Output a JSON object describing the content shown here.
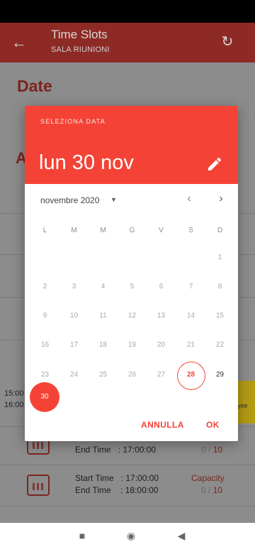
{
  "app_bar": {
    "title": "Time Slots",
    "subtitle": "SALA RIUNIONI",
    "back_icon": "arrow-left-icon",
    "refresh_icon": "refresh-icon"
  },
  "background": {
    "date_heading": "Date",
    "second_heading_partial": "A",
    "side_times": [
      "15:00",
      "16:00"
    ],
    "slots": [
      {
        "end_label": "End Time",
        "end_value": ": 17:00:00",
        "capacity_used": "0",
        "capacity_total": "10"
      },
      {
        "start_label": "Start Time",
        "start_value": ": 17:00:00",
        "end_label": "End Time",
        "end_value": ": 18:00:00",
        "capacity_label": "Capacity",
        "capacity_used": "0",
        "capacity_total": "10"
      }
    ],
    "yellow_chip": "yee"
  },
  "dialog": {
    "overline": "SELEZIONA DATA",
    "selected_date": "lun 30 nov",
    "month_label": "novembre 2020",
    "weekdays": [
      "L",
      "M",
      "M",
      "G",
      "V",
      "S",
      "D"
    ],
    "weeks": [
      [
        "",
        "",
        "",
        "",
        "",
        "",
        "1"
      ],
      [
        "2",
        "3",
        "4",
        "5",
        "6",
        "7",
        "8"
      ],
      [
        "9",
        "10",
        "11",
        "12",
        "13",
        "14",
        "15"
      ],
      [
        "16",
        "17",
        "18",
        "19",
        "20",
        "21",
        "22"
      ],
      [
        "23",
        "24",
        "25",
        "26",
        "27",
        "28",
        "29"
      ],
      [
        "30",
        "",
        "",
        "",
        "",
        "",
        ""
      ]
    ],
    "today": "28",
    "selected": "30",
    "cancel_label": "ANNULLA",
    "ok_label": "OK",
    "accent_color": "#f44336"
  },
  "nav": {
    "icons": [
      "stop-icon",
      "home-icon",
      "back-triangle-icon"
    ]
  }
}
